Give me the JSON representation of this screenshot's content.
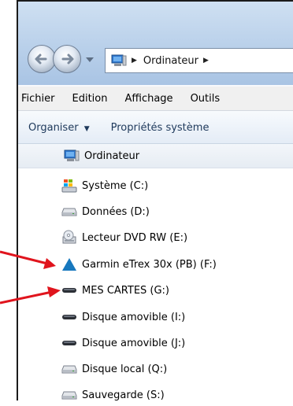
{
  "breadcrumb": {
    "location": "Ordinateur"
  },
  "menu": [
    "Fichier",
    "Edition",
    "Affichage",
    "Outils"
  ],
  "toolbar": {
    "organize": "Organiser",
    "system_properties": "Propriétés système"
  },
  "tree": {
    "root": "Ordinateur",
    "drives": [
      {
        "label": "Système (C:)",
        "icon": "windows-drive-icon"
      },
      {
        "label": "Données (D:)",
        "icon": "hard-drive-icon"
      },
      {
        "label": "Lecteur DVD RW (E:)",
        "icon": "dvd-drive-icon"
      },
      {
        "label": "Garmin eTrex 30x (PB) (F:)",
        "icon": "garmin-triangle-icon"
      },
      {
        "label": "MES CARTES (G:)",
        "icon": "removable-drive-icon"
      },
      {
        "label": "Disque amovible (I:)",
        "icon": "removable-drive-icon"
      },
      {
        "label": "Disque amovible (J:)",
        "icon": "removable-drive-icon"
      },
      {
        "label": "Disque local (Q:)",
        "icon": "hard-drive-icon"
      },
      {
        "label": "Sauvegarde (S:)",
        "icon": "hard-drive-icon"
      }
    ]
  },
  "colors": {
    "arrow": "#e0141d",
    "garmin": "#1778be",
    "titlebar": "#b9d0ea"
  }
}
